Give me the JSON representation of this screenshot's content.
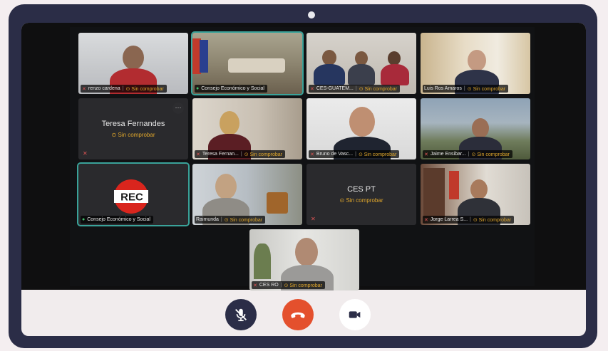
{
  "tiles": [
    {
      "name": "renzo cardena",
      "status": "Sin comprobar"
    },
    {
      "name": "Consejo Económico y Social",
      "status": ""
    },
    {
      "name": "CES-GUATEM...",
      "status": "Sin comprobar"
    },
    {
      "name": "Luis Ros Amaros",
      "status": "Sin comprobar"
    },
    {
      "name": "Teresa Fernandes",
      "status": "Sin comprobar"
    },
    {
      "name": "Teresa Fernan...",
      "status": "Sin comprobar"
    },
    {
      "name": "Bruno de Vasc...",
      "status": "Sin comprobar"
    },
    {
      "name": "Jaime Ensibar...",
      "status": "Sin comprobar"
    },
    {
      "name": "Consejo Económico y Social",
      "status": ""
    },
    {
      "name": "Raimunda",
      "status": "Sin comprobar"
    },
    {
      "name": "CES PT",
      "status": "Sin comprobar"
    },
    {
      "name": "Jorge Larrea S...",
      "status": "Sin comprobar"
    },
    {
      "name": "CES RO",
      "status": "Sin comprobar"
    }
  ],
  "rec_logo": "REC",
  "controls": {
    "mute_icon": "mic-off-icon",
    "hangup_icon": "phone-hangup-icon",
    "camera_icon": "video-camera-icon"
  },
  "colors": {
    "device_frame": "#2b2d47",
    "hangup": "#e4502d",
    "active_speaker": "#3aa39a",
    "unverified": "#e0a72c"
  }
}
